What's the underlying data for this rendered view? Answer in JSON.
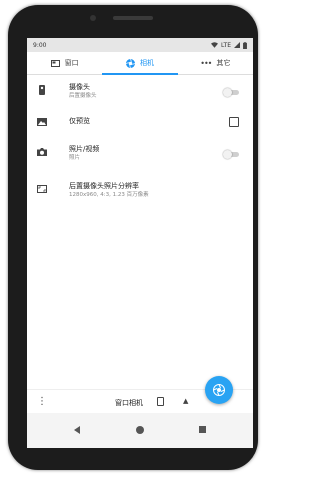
{
  "status_bar": {
    "time": "9:00",
    "network": "LTE"
  },
  "tabs": [
    {
      "label": "窗口",
      "icon": "window-icon"
    },
    {
      "label": "相机",
      "icon": "camera-aperture-icon"
    },
    {
      "label": "其它",
      "icon": "more-dots-icon"
    }
  ],
  "settings": {
    "camera": {
      "title": "摄像头",
      "subtitle": "后置摄像头",
      "icon": "phone-camera-icon",
      "toggle": "off"
    },
    "preview_only": {
      "title": "仅预览",
      "icon": "image-icon",
      "checked": false
    },
    "photo_video": {
      "title": "照片/视频",
      "subtitle": "照片",
      "icon": "camera-icon",
      "toggle": "off"
    },
    "resolution": {
      "title": "后置摄像头照片分辨率",
      "subtitle": "1280x960, 4:3, 1.23 百万像素",
      "icon": "aspect-ratio-icon"
    }
  },
  "bottom_bar": {
    "mode_label": "窗口相机",
    "menu_icon": "more-vert-icon",
    "caret": "▲"
  },
  "fab": {
    "icon": "shutter-icon"
  },
  "colors": {
    "accent": "#2196f3",
    "fab": "#29a3f3"
  }
}
